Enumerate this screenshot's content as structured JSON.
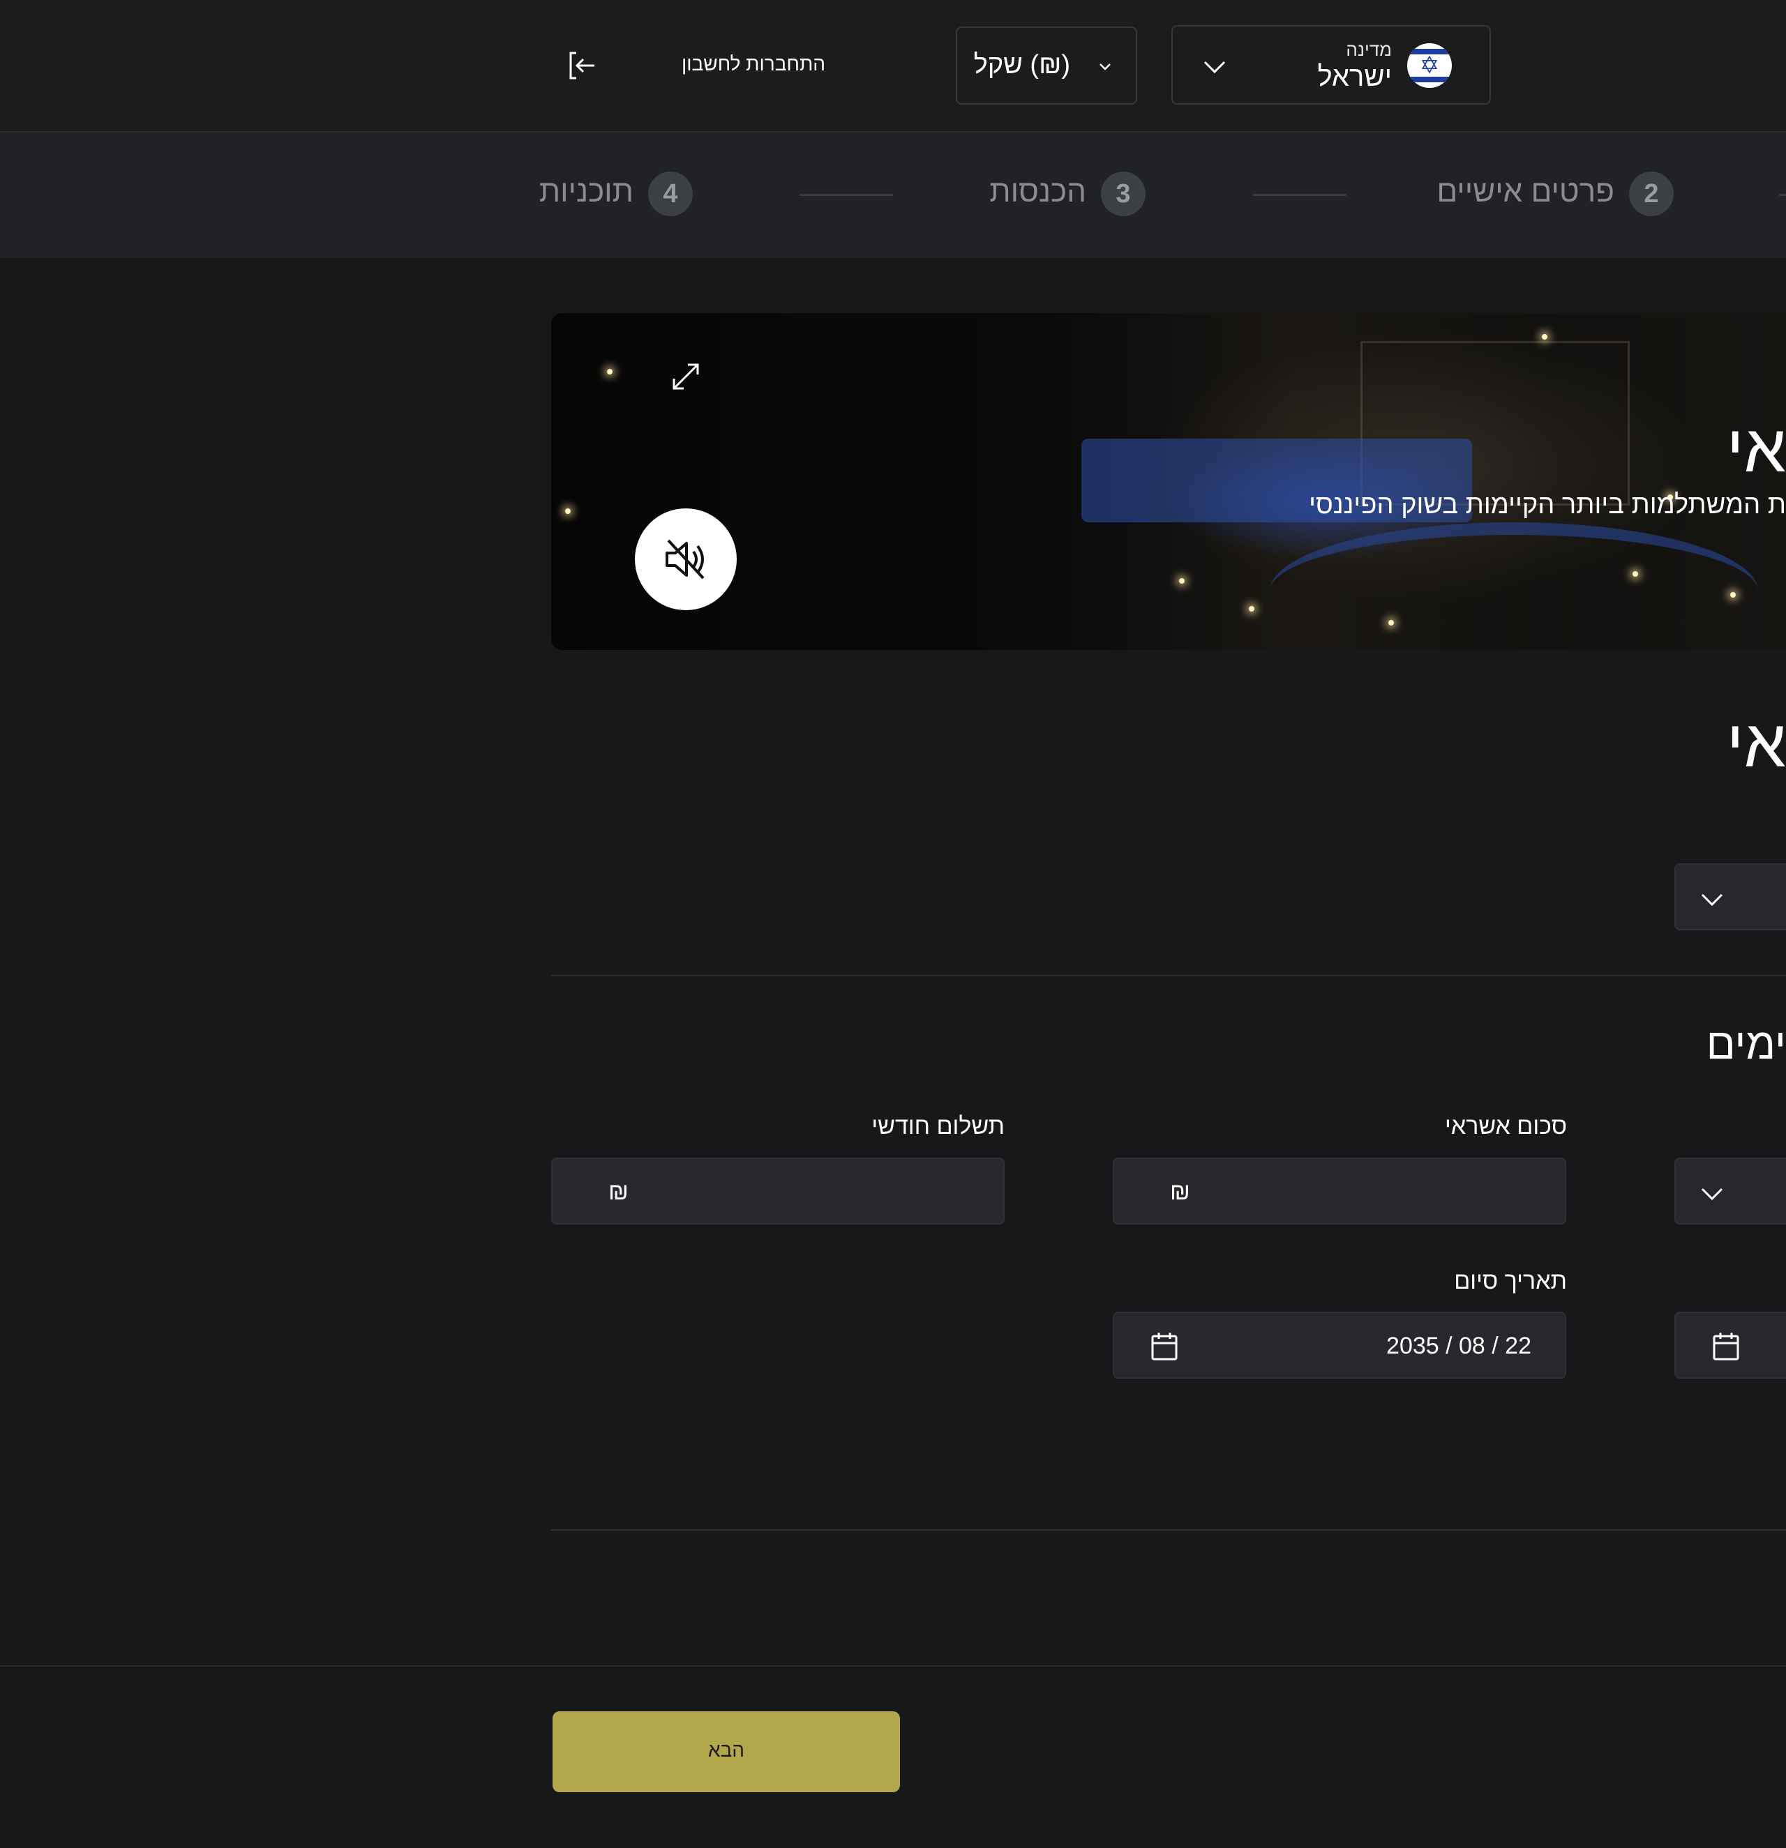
{
  "header": {
    "country": {
      "label": "מדינה",
      "value": "ישראל",
      "flag_icon": "israel-flag-icon"
    },
    "currency": {
      "value": "(₪) שקל"
    },
    "login": {
      "label": "התחברות לחשבון",
      "icon": "login-arrow-icon"
    }
  },
  "stepper": {
    "steps": [
      {
        "number": "2",
        "label": "פרטים אישיים"
      },
      {
        "number": "3",
        "label": "הכנסות"
      },
      {
        "number": "4",
        "label": "תוכניות"
      }
    ]
  },
  "video": {
    "title": "אי",
    "subtitle": "ת המשתלמות ביותר הקיימות בשוק הפיננסי",
    "expand_icon": "expand-icon",
    "mute_icon": "speaker-muted-icon"
  },
  "form": {
    "section1_title": "אי",
    "section2_title": "ימים",
    "credit_amount": {
      "label": "סכום אשראי",
      "currency_symbol": "₪"
    },
    "monthly_payment": {
      "label": "תשלום חודשי",
      "currency_symbol": "₪"
    },
    "end_date": {
      "label": "תאריך סיום",
      "value": "2035 / 08 / 22"
    }
  },
  "footer": {
    "next_label": "הבא"
  },
  "colors": {
    "accent": "#b3a74c",
    "background": "#171819",
    "field": "#26282c"
  }
}
